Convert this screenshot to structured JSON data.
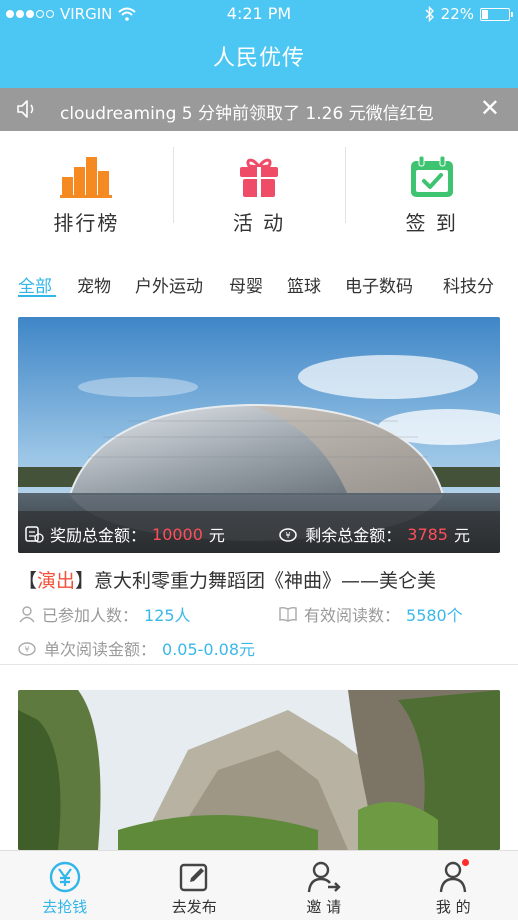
{
  "status_bar": {
    "carrier": "VIRGIN",
    "time": "4:21 PM",
    "battery": "22%",
    "battery_level": 0.22
  },
  "header": {
    "title": "人民优传"
  },
  "notice": {
    "message": "cloudreaming  5 分钟前领取了 1.26 元微信红包"
  },
  "shortcuts": [
    {
      "label": "排行榜",
      "icon": "bar-chart-icon"
    },
    {
      "label": "活 动",
      "icon": "gift-icon"
    },
    {
      "label": "签 到",
      "icon": "calendar-check-icon"
    }
  ],
  "categories": [
    "全部",
    "宠物",
    "户外运动",
    "母婴",
    "篮球",
    "电子数码",
    "科技分"
  ],
  "active_category": "全部",
  "cards": [
    {
      "image": "national-grand-theater-photo",
      "reward_label": "奖励总金额：",
      "reward_value": "10000",
      "reward_unit": "元",
      "remaining_label": "剩余总金额：",
      "remaining_value": "3785",
      "remaining_unit": "元",
      "tag": "演出",
      "title": "意大利零重力舞蹈团《神曲》——美仑美",
      "participants_label": "已参加人数：",
      "participants_value": "125人",
      "reads_label": "有效阅读数：",
      "reads_value": "5580个",
      "per_read_label": "单次阅读金额：",
      "per_read_value": "0.05-0.08元"
    },
    {
      "image": "mountain-canyon-photo"
    }
  ],
  "tabbar": [
    {
      "label": "去抢钱",
      "icon": "yuan-coin-icon",
      "active": true
    },
    {
      "label": "去发布",
      "icon": "edit-icon",
      "active": false
    },
    {
      "label": "邀 请",
      "icon": "invite-user-icon",
      "active": false
    },
    {
      "label": "我 的",
      "icon": "profile-icon",
      "active": false
    }
  ],
  "colors": {
    "accent": "#4cc6f2",
    "link": "#32b6ea",
    "tag": "#f0523a",
    "amount": "#ff4e59"
  }
}
